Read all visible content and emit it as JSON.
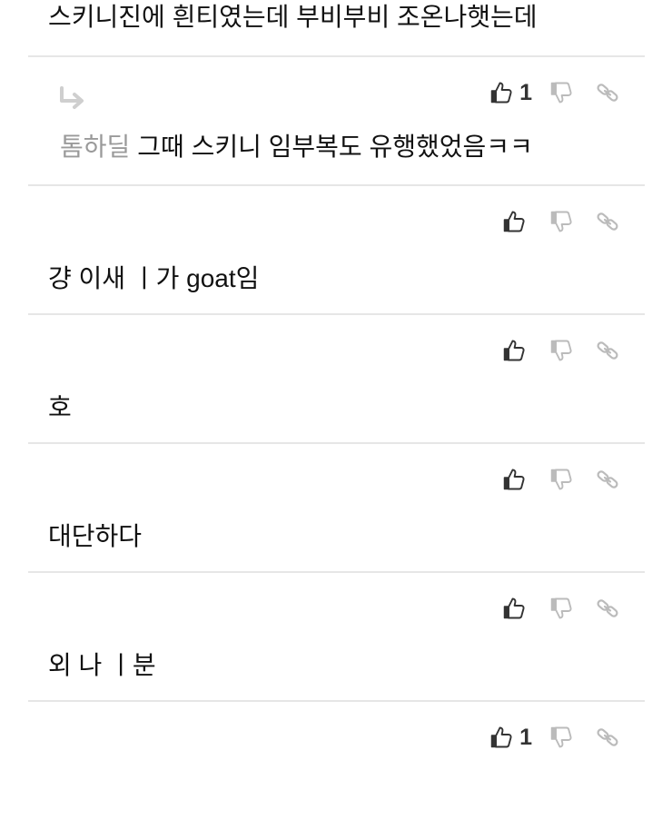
{
  "comments": [
    {
      "kind": "first",
      "text": "스키니진에 흰티였는데 부비부비 조온나햇는데"
    },
    {
      "kind": "reply",
      "mention": "톰하딜",
      "text": "그때 스키니 임부복도 유행했었음ㅋㅋ",
      "likes": "1"
    },
    {
      "kind": "regular",
      "text": "걍 이새 ㅣ가 goat임",
      "likes": ""
    },
    {
      "kind": "regular",
      "text": "호",
      "likes": ""
    },
    {
      "kind": "regular",
      "text": "대단하다",
      "likes": ""
    },
    {
      "kind": "regular",
      "text": "외 나 ㅣ분",
      "likes": ""
    },
    {
      "kind": "regular",
      "text": "",
      "likes": "1"
    }
  ],
  "icons": {
    "like": "thumbs-up-icon",
    "dislike": "thumbs-down-icon",
    "link": "link-icon",
    "reply": "reply-arrow-icon"
  },
  "colors": {
    "text": "#111111",
    "mention": "#9a9a9a",
    "divider": "#e6e6e6",
    "icon_dark": "#333333",
    "icon_light": "#bbbbbb"
  }
}
